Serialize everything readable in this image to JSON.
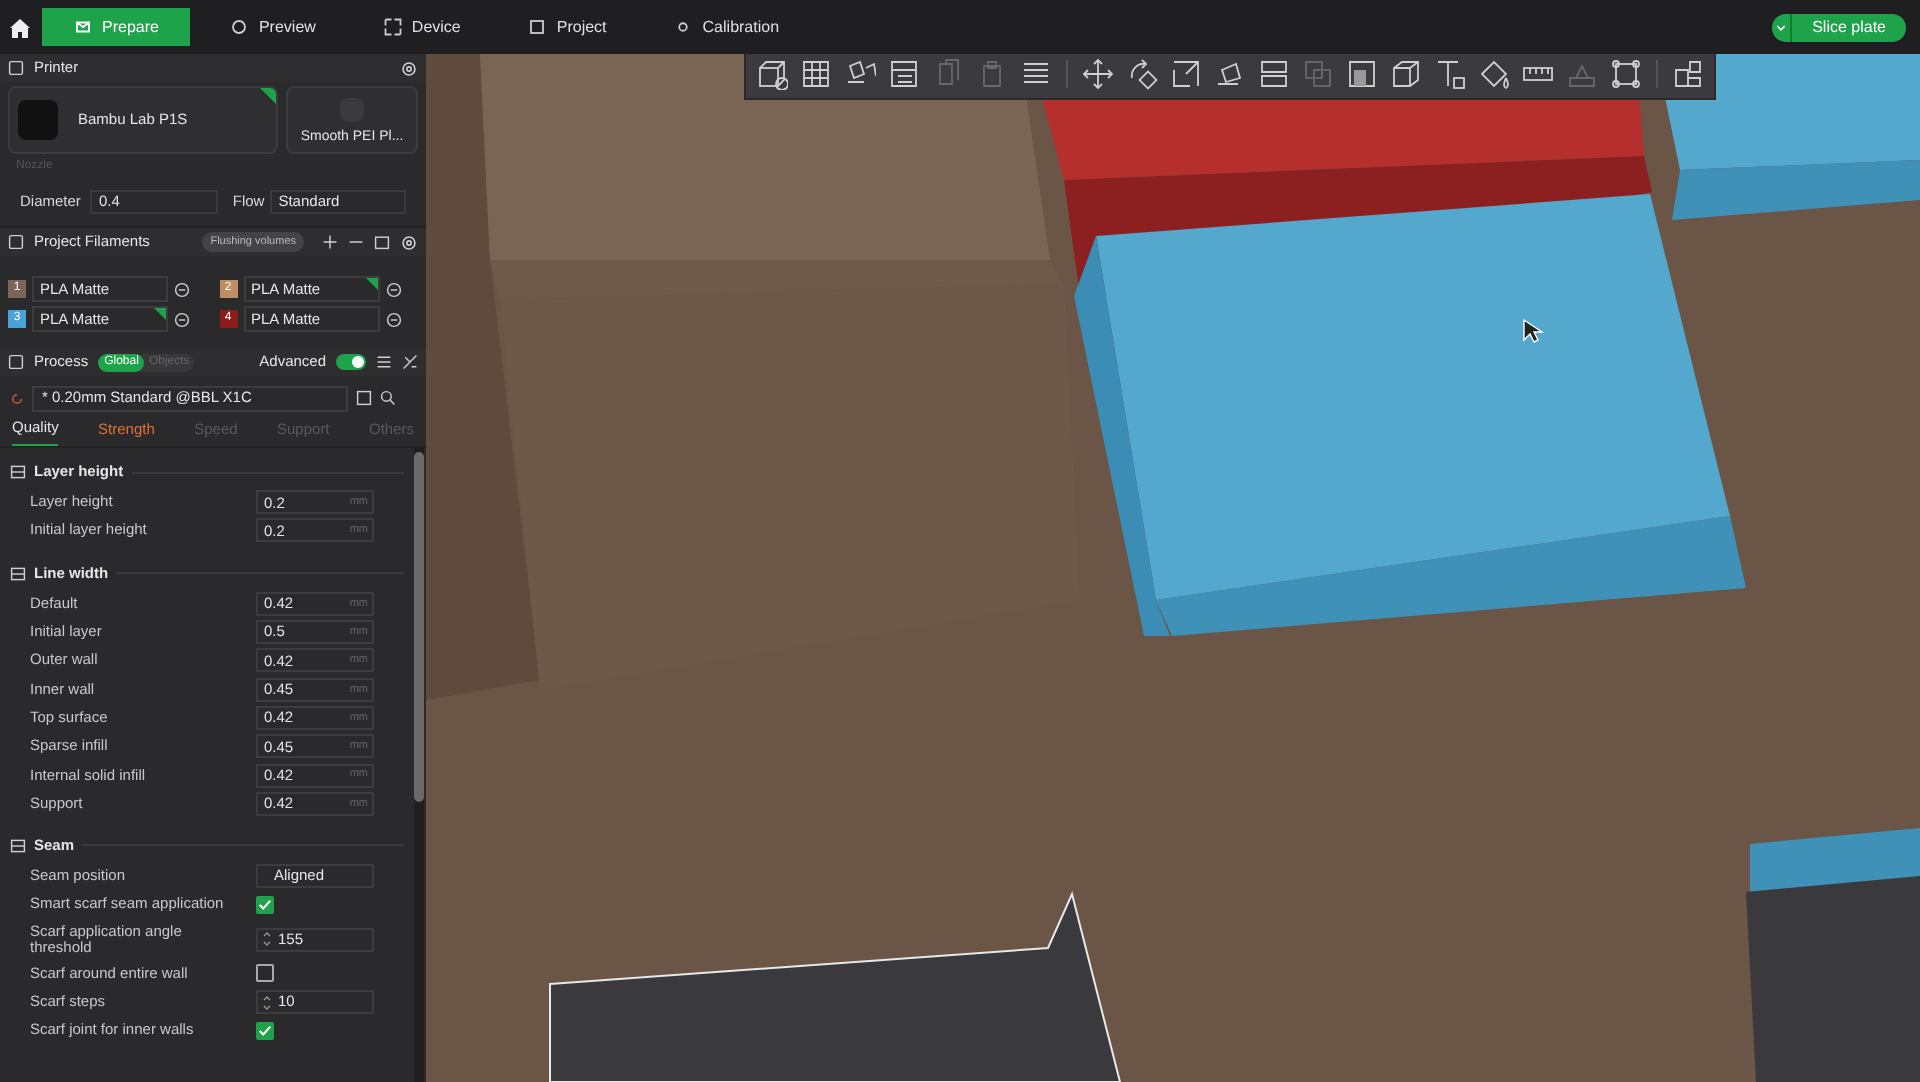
{
  "topbar": {
    "tabs": [
      {
        "label": "Prepare",
        "selected": true
      },
      {
        "label": "Preview",
        "selected": false
      },
      {
        "label": "Device",
        "selected": false
      },
      {
        "label": "Project",
        "selected": false
      },
      {
        "label": "Calibration",
        "selected": false
      }
    ],
    "slice_button": "Slice plate"
  },
  "printer": {
    "title": "Printer",
    "name": "Bambu Lab P1S",
    "synced": true,
    "plate": "Smooth PEI Pl...",
    "nozzle_label": "Nozzle",
    "diameter_label": "Diameter",
    "diameter": "0.4",
    "flow_label": "Flow",
    "flow": "Standard"
  },
  "filaments": {
    "title": "Project Filaments",
    "flushing_button": "Flushing volumes",
    "items": [
      {
        "number": "1",
        "color": "#7d6457",
        "name": "PLA Matte",
        "synced": false
      },
      {
        "number": "2",
        "color": "#c08d63",
        "name": "PLA Matte",
        "synced": true
      },
      {
        "number": "3",
        "color": "#4aa3d8",
        "name": "PLA Matte",
        "synced": true
      },
      {
        "number": "4",
        "color": "#8c1c1c",
        "name": "PLA Matte",
        "synced": false
      }
    ]
  },
  "process": {
    "title": "Process",
    "scope_tabs": [
      {
        "label": "Global",
        "selected": true
      },
      {
        "label": "Objects",
        "selected": false
      }
    ],
    "advanced_label": "Advanced",
    "advanced_on": true,
    "preset": "* 0.20mm Standard @BBL X1C",
    "tabs": [
      {
        "label": "Quality",
        "selected": true,
        "modified": false
      },
      {
        "label": "Strength",
        "selected": false,
        "modified": true
      },
      {
        "label": "Speed",
        "selected": false,
        "modified": false
      },
      {
        "label": "Support",
        "selected": false,
        "modified": false
      },
      {
        "label": "Others",
        "selected": false,
        "modified": false
      }
    ],
    "groups": [
      {
        "title": "Layer height",
        "rows": [
          {
            "kind": "number",
            "label": "Layer height",
            "value": "0.2",
            "unit": "mm"
          },
          {
            "kind": "number",
            "label": "Initial layer height",
            "value": "0.2",
            "unit": "mm"
          }
        ]
      },
      {
        "title": "Line width",
        "rows": [
          {
            "kind": "number",
            "label": "Default",
            "value": "0.42",
            "unit": "mm"
          },
          {
            "kind": "number",
            "label": "Initial layer",
            "value": "0.5",
            "unit": "mm"
          },
          {
            "kind": "number",
            "label": "Outer wall",
            "value": "0.42",
            "unit": "mm"
          },
          {
            "kind": "number",
            "label": "Inner wall",
            "value": "0.45",
            "unit": "mm"
          },
          {
            "kind": "number",
            "label": "Top surface",
            "value": "0.42",
            "unit": "mm"
          },
          {
            "kind": "number",
            "label": "Sparse infill",
            "value": "0.45",
            "unit": "mm"
          },
          {
            "kind": "number",
            "label": "Internal solid infill",
            "value": "0.42",
            "unit": "mm"
          },
          {
            "kind": "number",
            "label": "Support",
            "value": "0.42",
            "unit": "mm"
          }
        ]
      },
      {
        "title": "Seam",
        "rows": [
          {
            "kind": "select",
            "label": "Seam position",
            "value": "Aligned"
          },
          {
            "kind": "checkbox",
            "label": "Smart scarf seam application",
            "checked": true
          },
          {
            "kind": "spin",
            "label": "Scarf application angle threshold",
            "value": "155"
          },
          {
            "kind": "checkbox",
            "label": "Scarf around entire wall",
            "checked": false
          },
          {
            "kind": "spin",
            "label": "Scarf steps",
            "value": "10"
          },
          {
            "kind": "checkbox",
            "label": "Scarf joint for inner walls",
            "checked": true
          }
        ]
      }
    ]
  },
  "toolbar": {
    "tool_groups": [
      [
        {
          "disabled": false
        },
        {
          "disabled": false
        },
        {
          "disabled": false
        },
        {
          "disabled": false
        },
        {
          "disabled": true
        },
        {
          "disabled": true
        },
        {
          "disabled": false
        }
      ],
      [
        {
          "disabled": false
        },
        {
          "disabled": false
        },
        {
          "disabled": false
        },
        {
          "disabled": false
        },
        {
          "disabled": false
        },
        {
          "disabled": true
        },
        {
          "disabled": false
        },
        {
          "disabled": false
        },
        {
          "disabled": false
        },
        {
          "disabled": false
        },
        {
          "disabled": false
        },
        {
          "disabled": true
        },
        {
          "disabled": false
        }
      ],
      [
        {
          "disabled": false
        }
      ]
    ]
  }
}
